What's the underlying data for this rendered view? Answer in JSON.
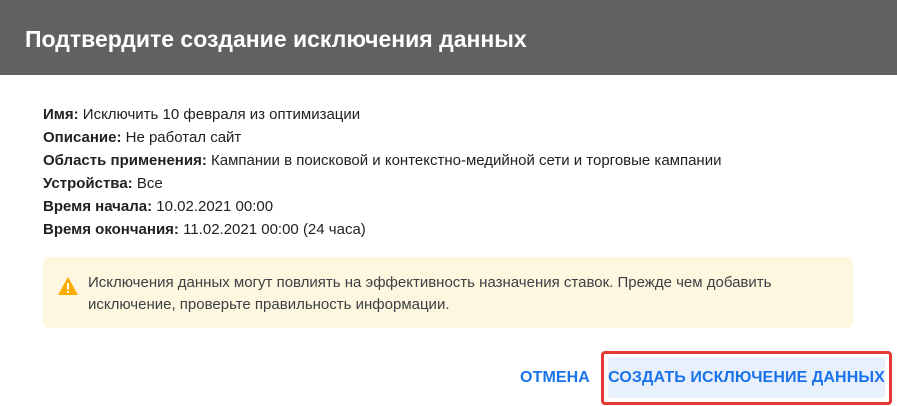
{
  "dialog": {
    "title": "Подтвердите создание исключения данных"
  },
  "details": [
    {
      "label": "Имя:",
      "value": "Исключить 10 февраля из оптимизации"
    },
    {
      "label": "Описание:",
      "value": "Не работал сайт"
    },
    {
      "label": "Область применения:",
      "value": "Кампании в поисковой и контекстно-медийной сети и торговые кампании"
    },
    {
      "label": "Устройства:",
      "value": "Все"
    },
    {
      "label": "Время начала:",
      "value": "10.02.2021 00:00"
    },
    {
      "label": "Время окончания:",
      "value": "11.02.2021 00:00 (24 часа)"
    }
  ],
  "warning": {
    "icon": "warning-triangle-icon",
    "text": "Исключения данных могут повлиять на эффективность назначения ставок. Прежде чем добавить исключение, проверьте правильность информации."
  },
  "actions": {
    "cancel_label": "ОТМЕНА",
    "confirm_label": "СОЗДАТЬ ИСКЛЮЧЕНИЕ ДАННЫХ"
  },
  "colors": {
    "header_bg": "#616161",
    "accent": "#1a73e8",
    "warning_bg": "#fef7e0",
    "warning_icon": "#f9ab00",
    "highlight_border": "#e53935"
  }
}
